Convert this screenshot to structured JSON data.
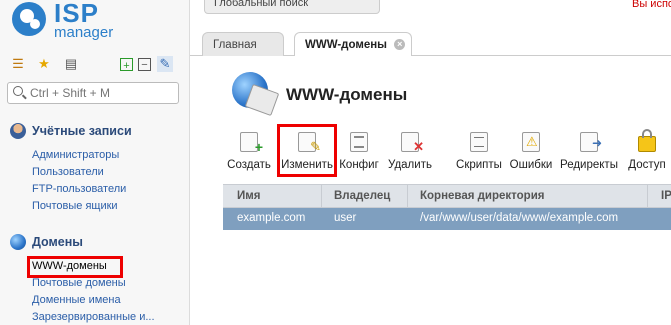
{
  "app": {
    "logo_line1": "ISP",
    "logo_line2": "manager"
  },
  "topbar": {
    "search_placeholder": "Глобальный поиск",
    "alert_text": "Вы испо"
  },
  "sidebar": {
    "search_placeholder": "Ctrl + Shift + M",
    "groups": [
      {
        "title": "Учётные записи",
        "items": [
          "Администраторы",
          "Пользователи",
          "FTP-пользователи",
          "Почтовые ящики"
        ]
      },
      {
        "title": "Домены",
        "items": [
          "WWW-домены",
          "Почтовые домены",
          "Доменные имена",
          "Зарезервированные и..."
        ]
      }
    ]
  },
  "tabs": [
    {
      "label": "Главная"
    },
    {
      "label": "WWW-домены"
    }
  ],
  "page": {
    "title": "WWW-домены"
  },
  "toolbar": {
    "buttons": [
      "Создать",
      "Изменить",
      "Конфиг",
      "Удалить",
      "Скрипты",
      "Ошибки",
      "Редиректы",
      "Доступ"
    ]
  },
  "table": {
    "columns": [
      "Имя",
      "Владелец",
      "Корневая директория",
      "IP"
    ],
    "rows": [
      [
        "example.com",
        "user",
        "/var/www/user/data/www/example.com",
        ""
      ]
    ]
  },
  "colors": {
    "accent": "#2c7fc9",
    "highlight": "#ee0000",
    "selected_row": "#7f9fbf",
    "header_bg": "#dfe3e8"
  }
}
